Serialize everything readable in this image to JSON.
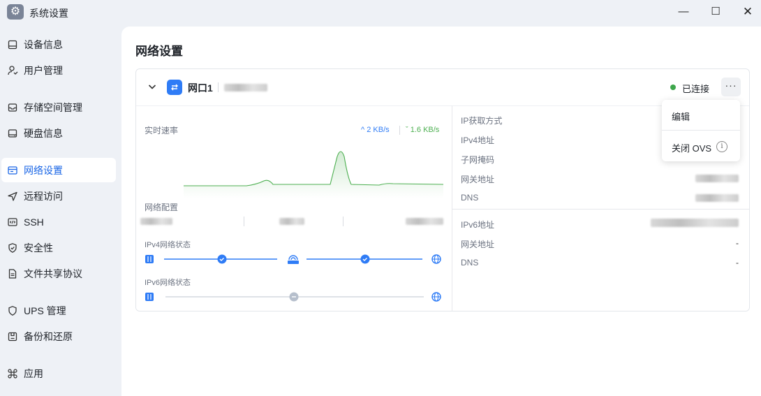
{
  "window": {
    "title": "系统设置",
    "app_icon": "gear-icon"
  },
  "sidebar": {
    "items": [
      {
        "label": "设备信息",
        "icon": "device-icon"
      },
      {
        "label": "用户管理",
        "icon": "user-icon"
      },
      {
        "label": "存储空间管理",
        "icon": "storage-icon"
      },
      {
        "label": "硬盘信息",
        "icon": "disk-icon"
      },
      {
        "label": "网络设置",
        "icon": "network-icon",
        "active": true
      },
      {
        "label": "远程访问",
        "icon": "send-icon"
      },
      {
        "label": "SSH",
        "icon": "code-icon"
      },
      {
        "label": "安全性",
        "icon": "shield-icon"
      },
      {
        "label": "文件共享协议",
        "icon": "file-icon"
      },
      {
        "label": "UPS 管理",
        "icon": "ups-shield-icon"
      },
      {
        "label": "备份和还原",
        "icon": "backup-icon"
      },
      {
        "label": "应用",
        "icon": "command-icon"
      }
    ]
  },
  "main": {
    "title": "网络设置",
    "port": {
      "name": "网口1",
      "status": "已连接",
      "status_color": "#3ea64b",
      "more": "···",
      "speed": {
        "label": "实时速率",
        "upload": "2 KB/s",
        "download": "1.6 KB/s",
        "upload_color": "#2f7cf6",
        "download_color": "#4caf50"
      },
      "config_label": "网络配置",
      "ipv4_status_label": "IPv4网络状态",
      "ipv6_status_label": "IPv6网络状态",
      "details_v4": [
        {
          "label": "IP获取方式"
        },
        {
          "label": "IPv4地址"
        },
        {
          "label": "子网掩码"
        },
        {
          "label": "网关地址"
        },
        {
          "label": "DNS"
        }
      ],
      "details_v6": [
        {
          "label": "IPv6地址",
          "value": ""
        },
        {
          "label": "网关地址",
          "value": "-"
        },
        {
          "label": "DNS",
          "value": "-"
        }
      ]
    },
    "menu": {
      "edit": "编辑",
      "close_ovs": "关闭 OVS",
      "info": "i"
    }
  }
}
